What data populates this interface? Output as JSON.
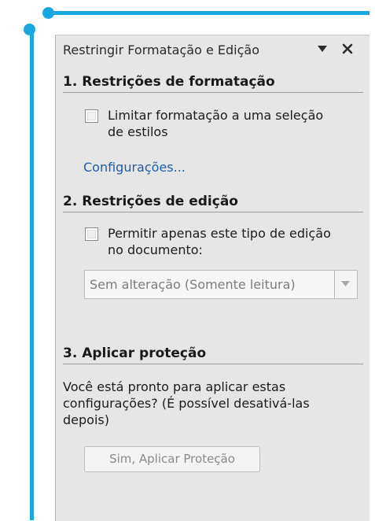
{
  "pane": {
    "title": "Restringir Formatação e Edição",
    "icons": {
      "menu": "chevron-down-icon",
      "close": "close-icon"
    }
  },
  "formatting": {
    "title": "1. Restrições de formatação",
    "checkbox_label_line1": "Limitar formatação a uma seleção",
    "checkbox_label_line2": "de estilos",
    "checked": false,
    "settings_link": "Configurações..."
  },
  "editing": {
    "title": "2. Restrições de edição",
    "checkbox_label_line1": "Permitir apenas este tipo de edição",
    "checkbox_label_line2": "no documento:",
    "checked": false,
    "select_value": "Sem alteração (Somente leitura)"
  },
  "protection": {
    "title": "3. Aplicar proteção",
    "text_line1": "Você está pronto para aplicar estas",
    "text_line2": "configurações? (É possível desativá-las",
    "text_line3": "depois)",
    "button_label": "Sim, Aplicar Proteção"
  },
  "colors": {
    "accent": "#19a7df",
    "pane_bg": "#e6e6e6",
    "link": "#1f5fa8"
  }
}
